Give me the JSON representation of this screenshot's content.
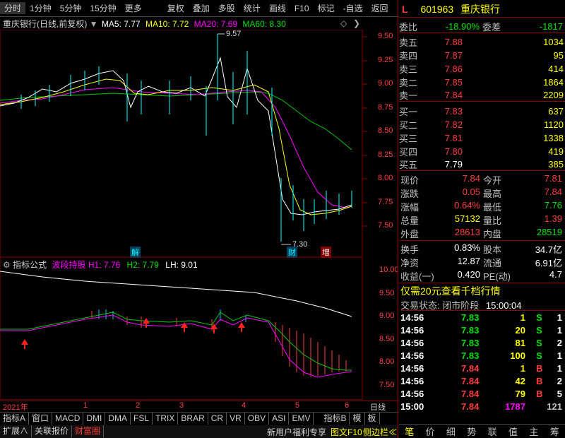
{
  "toolbar": {
    "items": [
      "分时",
      "1分钟",
      "5分钟",
      "15分钟",
      "更多",
      "复权",
      "叠加",
      "多股",
      "统计",
      "画线",
      "F10",
      "标记",
      "-自选",
      "返回"
    ]
  },
  "chart_header": {
    "title": "重庆银行(日线,前复权)",
    "ma5": "MA5: 7.77",
    "ma10": "MA10: 7.72",
    "ma20": "MA20: 7.69",
    "ma60": "MA60: 8.30"
  },
  "price_axis": [
    "9.50",
    "9.25",
    "9.00",
    "8.75",
    "8.50",
    "8.25",
    "8.00",
    "7.75",
    "7.50"
  ],
  "price_markers": {
    "high": "9.57",
    "low": "7.30"
  },
  "event_tags": [
    "解",
    "财",
    "增"
  ],
  "indicator_header": {
    "name": "指标公式",
    "formula": "波段持股",
    "h1": "H1: 7.76",
    "h2": "H2: 7.79",
    "lh": "LH: 9.01"
  },
  "indicator_axis": [
    "10.00",
    "9.50",
    "9.00",
    "8.50",
    "8.00",
    "7.50"
  ],
  "x_axis": {
    "year": "2021年",
    "months": [
      "1",
      "2",
      "3",
      "4",
      "5",
      "6"
    ],
    "period": "日线"
  },
  "bottom_tabs": [
    "指标A",
    "窗口",
    "MACD",
    "DMI",
    "DMA",
    "FSL",
    "TRIX",
    "BRAR",
    "CR",
    "VR",
    "OBV",
    "ASI",
    "EMV",
    "指标B",
    "模",
    "板"
  ],
  "bottom_bar": {
    "left": [
      "扩展∧",
      "关联报价",
      "财富圈"
    ],
    "promo": "新用户福利专享",
    "right": [
      "图文F10",
      "侧边栏≪"
    ]
  },
  "stock": {
    "code": "601963",
    "name": "重庆银行",
    "market_mark": "L"
  },
  "weibi": {
    "label": "委比",
    "value": "-18.90%",
    "label2": "委差",
    "value2": "-1817"
  },
  "asks": [
    {
      "label": "卖五",
      "price": "7.88",
      "vol": "1034"
    },
    {
      "label": "卖四",
      "price": "7.87",
      "vol": "95"
    },
    {
      "label": "卖三",
      "price": "7.86",
      "vol": "414"
    },
    {
      "label": "卖二",
      "price": "7.85",
      "vol": "1864"
    },
    {
      "label": "卖一",
      "price": "7.84",
      "vol": "2209"
    }
  ],
  "bids": [
    {
      "label": "买一",
      "price": "7.83",
      "vol": "637"
    },
    {
      "label": "买二",
      "price": "7.82",
      "vol": "1120"
    },
    {
      "label": "买三",
      "price": "7.81",
      "vol": "1338"
    },
    {
      "label": "买四",
      "price": "7.80",
      "vol": "419"
    },
    {
      "label": "买五",
      "price": "7.79",
      "vol": "385"
    }
  ],
  "quote": [
    {
      "l1": "现价",
      "v1": "7.84",
      "l2": "今开",
      "v2": "7.81"
    },
    {
      "l1": "涨跌",
      "v1": "0.05",
      "l2": "最高",
      "v2": "7.84"
    },
    {
      "l1": "涨幅",
      "v1": "0.64%",
      "l2": "最低",
      "v2": "7.76"
    },
    {
      "l1": "总量",
      "v1": "57132",
      "l2": "量比",
      "v2": "1.39"
    },
    {
      "l1": "外盘",
      "v1": "28613",
      "l2": "内盘",
      "v2": "28519"
    }
  ],
  "quote2": [
    {
      "l1": "换手",
      "v1": "0.83%",
      "l2": "股本",
      "v2": "34.7亿"
    },
    {
      "l1": "净资",
      "v1": "12.87",
      "l2": "流通",
      "v2": "6.91亿"
    },
    {
      "l1": "收益(一)",
      "v1": "0.420",
      "l2": "PE(动)",
      "v2": "4.7"
    }
  ],
  "promo_line": "仅需20元查看千档行情",
  "trade_status": {
    "label": "交易状态:",
    "state": "闭市阶段",
    "time": "15:00:04"
  },
  "ticks": [
    {
      "t": "14:56",
      "p": "7.83",
      "v": "1",
      "s": "S",
      "n": "1"
    },
    {
      "t": "14:56",
      "p": "7.83",
      "v": "20",
      "s": "S",
      "n": "1"
    },
    {
      "t": "14:56",
      "p": "7.83",
      "v": "81",
      "s": "S",
      "n": "2"
    },
    {
      "t": "14:56",
      "p": "7.83",
      "v": "100",
      "s": "S",
      "n": "1"
    },
    {
      "t": "14:56",
      "p": "7.84",
      "v": "1",
      "s": "B",
      "n": "1"
    },
    {
      "t": "14:56",
      "p": "7.84",
      "v": "42",
      "s": "B",
      "n": "2"
    },
    {
      "t": "14:56",
      "p": "7.84",
      "v": "79",
      "s": "B",
      "n": "5"
    },
    {
      "t": "15:00",
      "p": "7.84",
      "v": "1787",
      "s": "",
      "n": "121"
    }
  ],
  "right_tabs": [
    "笔",
    "价",
    "细",
    "势",
    "联",
    "值",
    "主",
    "筹"
  ]
}
